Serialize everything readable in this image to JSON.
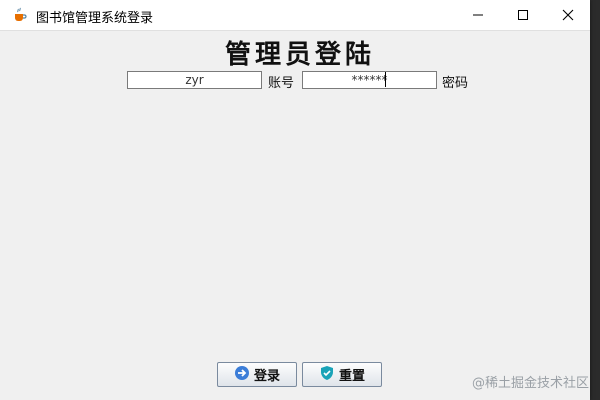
{
  "window": {
    "title": "图书馆管理系统登录"
  },
  "form": {
    "heading": "管理员登陆",
    "account_value": "zyr",
    "account_label": "账号",
    "password_value": "******",
    "password_label": "密码"
  },
  "buttons": {
    "login_label": "登录",
    "reset_label": "重置"
  },
  "watermark": "@稀土掘金技术社区",
  "icons": {
    "app": "java-cup-icon",
    "minimize": "minimize-icon",
    "maximize": "maximize-icon",
    "close": "close-icon",
    "login": "login-arrow-icon",
    "reset": "reset-shield-icon"
  }
}
